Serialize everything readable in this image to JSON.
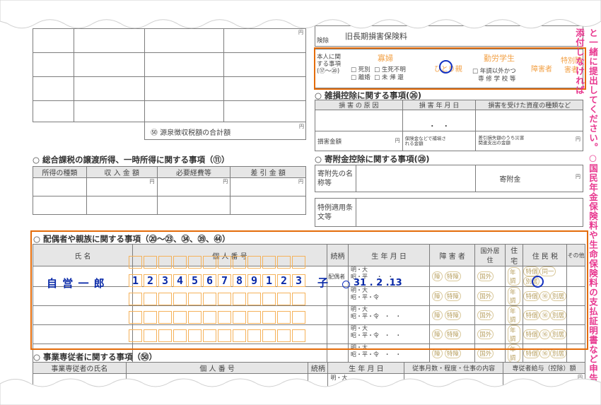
{
  "left": {
    "yen": "円",
    "withholding_total": "㊿ 源泉徴収税額の合計額",
    "comprehensive_section": "○ 総合課税の譲渡所得、一時所得に関する事項（⑪）",
    "cols": [
      "所得の種類",
      "収 入 金 額",
      "必要経費等",
      "差 引 金 額"
    ]
  },
  "top_right": {
    "insurance_label": "旧長期損害保険料",
    "insurance_side": "険除",
    "personal_label": "本人に関する事項",
    "personal_range": "(⑰〜⑳)",
    "widow": "寡婦",
    "single_parent": "ひとり親",
    "working_student": "勤労学生",
    "disabled": "障害者",
    "special_disabled": "特別障害者",
    "widow_options": [
      "□ 死別",
      "□ 生死不明",
      "□ 離婚",
      "□ 未 帰 還"
    ],
    "student_options": [
      "□ 年調以外かつ",
      "専 修 学 校 等"
    ]
  },
  "casualty": {
    "title": "○ 雑損控除に関する事項(㉖)",
    "cols": [
      "損 害 の 原 因",
      "損 害 年 月 日",
      "損害を受けた資産の種類など"
    ],
    "damage_amount": "損害金額",
    "insurance_note": "保険金などで補塡される金額",
    "disaster_note": "差引損失額のうち災害関連支出の金額"
  },
  "donation": {
    "title": "○ 寄附金控除に関する事項(㉘)",
    "recipient": "寄附先の名称等",
    "amount": "寄附金",
    "special_clause": "特例適用条文等"
  },
  "spouse": {
    "title": "○ 配偶者や親族に関する事項（⑳〜㉓、㉞、㊴、㊹）",
    "headers": [
      "氏 名",
      "個 人 番 号",
      "続柄",
      "生 年 月 日",
      "障 害 者",
      "国外居住",
      "住宅",
      "住 民 税",
      "その他"
    ],
    "spouse_label": "配偶者",
    "era_line1": "明・大",
    "era_line2": "昭・平・令",
    "era_line2_first": "昭・平",
    "disability_chips": [
      "障",
      "特障"
    ],
    "abroad_chips": [
      "国外",
      "年調"
    ],
    "tax_chips": [
      "特個",
      "⑯",
      "別居"
    ],
    "tax_chips_first": [
      "特個",
      "同一",
      "別居"
    ],
    "filled": {
      "name": "自 営 一 郎",
      "number": [
        "1",
        "2",
        "3",
        "4",
        "5",
        "6",
        "7",
        "8",
        "9",
        "1",
        "2",
        "3"
      ],
      "relation": "子",
      "birth": "31 . 2 .13"
    }
  },
  "employees": {
    "title": "○ 事業専従者に関する事項（㊿）",
    "headers": [
      "事業専従者の氏名",
      "個 人 番 号",
      "続柄",
      "生 年 月 日",
      "従事月数・程度・仕事の内容",
      "専従者給与（控除）額"
    ]
  },
  "side_note": "と一緒に提出してください。○国民年金保険料や生命保険料の支払証明書など申告書に添付しなければ"
}
